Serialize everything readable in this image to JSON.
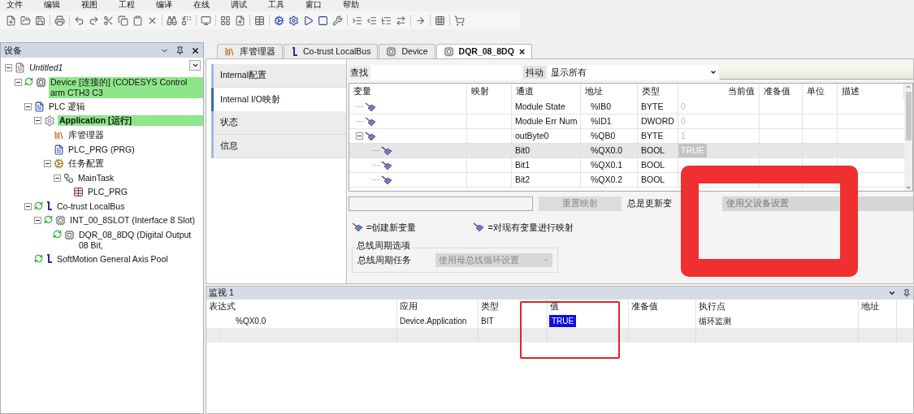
{
  "menu": [
    "文件",
    "编辑",
    "视图",
    "工程",
    "编译",
    "在线",
    "调试",
    "工具",
    "窗口",
    "帮助"
  ],
  "devices_panel": {
    "title": "设备",
    "tree": [
      {
        "label": "Untitled1",
        "kind": "project",
        "online": false,
        "highlighted": false,
        "expanded": true,
        "children": [
          {
            "label": "Device [连接的] (CODESYS Control arm CTH3 C3",
            "kind": "device",
            "online": true,
            "highlighted": true,
            "expanded": true,
            "children": [
              {
                "label": "PLC 逻辑",
                "kind": "logic",
                "online": false,
                "highlighted": false,
                "expanded": true,
                "children": [
                  {
                    "label": "Application [运行]",
                    "kind": "application",
                    "online": false,
                    "highlighted": true,
                    "expanded": true,
                    "children": [
                      {
                        "label": "库管理器",
                        "kind": "library",
                        "online": false,
                        "highlighted": false
                      },
                      {
                        "label": "PLC_PRG (PRG)",
                        "kind": "program",
                        "online": false,
                        "highlighted": false
                      },
                      {
                        "label": "任务配置",
                        "kind": "tasks",
                        "online": false,
                        "highlighted": false,
                        "expanded": true,
                        "children": [
                          {
                            "label": "MainTask",
                            "kind": "task",
                            "online": false,
                            "highlighted": false,
                            "expanded": true,
                            "children": [
                              {
                                "label": "PLC_PRG",
                                "kind": "pou",
                                "online": false,
                                "highlighted": false
                              }
                            ]
                          }
                        ]
                      }
                    ]
                  }
                ]
              },
              {
                "label": "Co-trust LocalBus",
                "kind": "bus",
                "online": true,
                "highlighted": false,
                "expanded": true,
                "children": [
                  {
                    "label": "INT_00_8SLOT (Interface 8 Slot)",
                    "kind": "module",
                    "online": true,
                    "highlighted": false,
                    "expanded": true,
                    "children": [
                      {
                        "label": "DQR_08_8DQ (Digital Output 08 Bit,",
                        "kind": "module",
                        "online": true,
                        "highlighted": false
                      }
                    ]
                  }
                ]
              },
              {
                "label": "SoftMotion General Axis Pool",
                "kind": "bus",
                "online": true,
                "highlighted": false
              }
            ]
          }
        ]
      }
    ]
  },
  "editor_tabs": [
    {
      "label": "库管理器",
      "kind": "library",
      "selected": false
    },
    {
      "label": "Co-trust LocalBus",
      "kind": "bus",
      "selected": false
    },
    {
      "label": "Device",
      "kind": "module",
      "selected": false
    },
    {
      "label": "DQR_08_8DQ",
      "kind": "module",
      "selected": true,
      "close": "×"
    }
  ],
  "side_tabs": [
    {
      "label": "Internal配置",
      "selected": false
    },
    {
      "label": "Internal I/O映射",
      "selected": true
    },
    {
      "label": "状态",
      "selected": false
    },
    {
      "label": "信息",
      "selected": false
    }
  ],
  "filter_bar": {
    "find_label": "查找",
    "jitter_label": "抖动",
    "show_value": "显示所有"
  },
  "io_table": {
    "columns": [
      "变量",
      "映射",
      "通道",
      "地址",
      "类型",
      "当前值",
      "准备值",
      "单位",
      "描述"
    ],
    "rows": [
      {
        "channel": "Module State",
        "address": "%IB0",
        "type": "BYTE",
        "current": "0",
        "selected": false,
        "kind": "input"
      },
      {
        "channel": "Module Err Num",
        "address": "%ID1",
        "type": "DWORD",
        "current": "0",
        "selected": false,
        "kind": "input"
      },
      {
        "channel": "outByte0",
        "address": "%QB0",
        "type": "BYTE",
        "current": "1",
        "selected": false,
        "kind": "output",
        "expanded": true,
        "children": [
          {
            "channel": "Bit0",
            "address": "%QX0.0",
            "type": "BOOL",
            "current": "TRUE",
            "selected": true,
            "kind": "output"
          },
          {
            "channel": "Bit1",
            "address": "%QX0.1",
            "type": "BOOL",
            "selected": false,
            "kind": "output"
          },
          {
            "channel": "Bit2",
            "address": "%QX0.2",
            "type": "BOOL",
            "selected": false,
            "kind": "output"
          }
        ]
      }
    ]
  },
  "mapping_bar": {
    "reset_button": "重置映射",
    "update_label": "总是更新变",
    "update_value": "使用父设备设置"
  },
  "legend": [
    {
      "text": "=创建新变量",
      "kind": "new"
    },
    {
      "text": "=对现有变量进行映射",
      "kind": "existing"
    }
  ],
  "bus_cycle": {
    "title": "总线周期选项",
    "label": "总线周期任务",
    "value": "使用母总线循环设置"
  },
  "watch_panel": {
    "title": "监视 1",
    "columns": [
      "表达式",
      "应用",
      "类型",
      "值",
      "准备值",
      "执行点",
      "地址"
    ],
    "rows": [
      {
        "expression": "%QX0.0",
        "application": "Device.Application",
        "type": "BIT",
        "value": "TRUE",
        "prepared": "",
        "exec_point": "循环监测"
      }
    ]
  }
}
